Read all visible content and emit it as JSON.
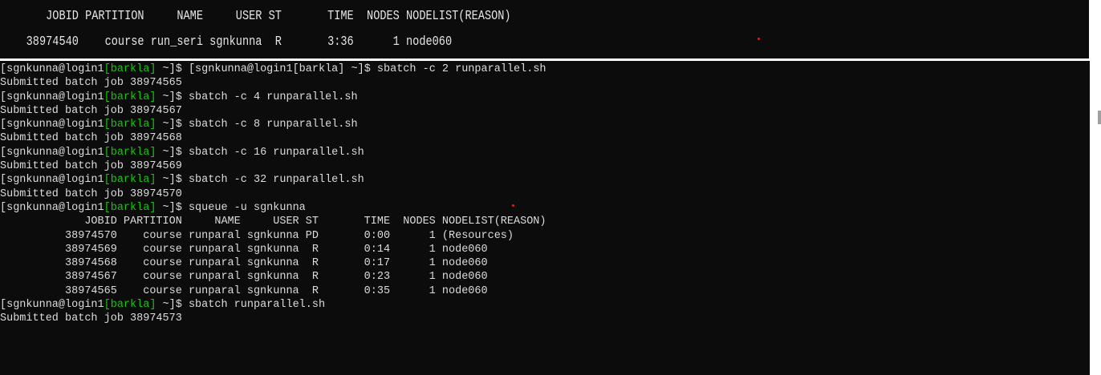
{
  "top_panel": {
    "line1": "       JOBID PARTITION     NAME     USER ST       TIME  NODES NODELIST(REASON)",
    "line2": "    38974540    course run_seri sgnkunna  R       3:36      1 node060"
  },
  "prompt": {
    "user_host": "[sgnkunna@login1",
    "cluster": "[barkla]",
    "dir": " ~]$ "
  },
  "terminal_lines": [
    {
      "type": "prompt",
      "cmd": "[sgnkunna@login1[barkla] ~]$ sbatch -c 2 runparallel.sh"
    },
    {
      "type": "out",
      "text": "Submitted batch job 38974565"
    },
    {
      "type": "prompt",
      "cmd": "sbatch -c 4 runparallel.sh"
    },
    {
      "type": "out",
      "text": "Submitted batch job 38974567"
    },
    {
      "type": "prompt",
      "cmd": "sbatch -c 8 runparallel.sh"
    },
    {
      "type": "out",
      "text": "Submitted batch job 38974568"
    },
    {
      "type": "prompt",
      "cmd": "sbatch -c 16 runparallel.sh"
    },
    {
      "type": "out",
      "text": "Submitted batch job 38974569"
    },
    {
      "type": "prompt",
      "cmd": "sbatch -c 32 runparallel.sh"
    },
    {
      "type": "out",
      "text": "Submitted batch job 38974570"
    },
    {
      "type": "prompt",
      "cmd": "squeue -u sgnkunna"
    },
    {
      "type": "out",
      "text": "             JOBID PARTITION     NAME     USER ST       TIME  NODES NODELIST(REASON)"
    },
    {
      "type": "out",
      "text": "          38974570    course runparal sgnkunna PD       0:00      1 (Resources)"
    },
    {
      "type": "out",
      "text": "          38974569    course runparal sgnkunna  R       0:14      1 node060"
    },
    {
      "type": "out",
      "text": "          38974568    course runparal sgnkunna  R       0:17      1 node060"
    },
    {
      "type": "out",
      "text": "          38974567    course runparal sgnkunna  R       0:23      1 node060"
    },
    {
      "type": "out",
      "text": "          38974565    course runparal sgnkunna  R       0:35      1 node060"
    },
    {
      "type": "prompt",
      "cmd": "sbatch runparallel.sh"
    },
    {
      "type": "out",
      "text": "Submitted batch job 38974573"
    }
  ],
  "colors": {
    "background": "#0c0c0c",
    "text": "#dcdcdc",
    "cluster_tag": "#16c60c"
  }
}
